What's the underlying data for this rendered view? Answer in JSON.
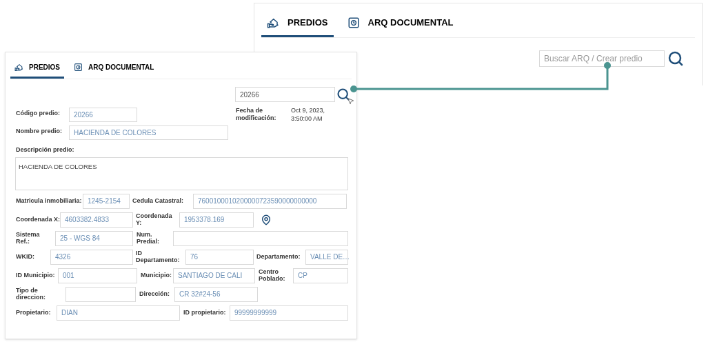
{
  "back_panel": {
    "tabs": [
      {
        "label": "PREDIOS",
        "kind": "house",
        "selected": true
      },
      {
        "label": "ARQ DOCUMENTAL",
        "kind": "document",
        "selected": false
      }
    ],
    "search": {
      "placeholder": "Buscar ARQ / Crear predio"
    }
  },
  "front_panel": {
    "tabs": [
      {
        "label": "PREDIOS",
        "kind": "house",
        "selected": true
      },
      {
        "label": "ARQ DOCUMENTAL",
        "kind": "document",
        "selected": false
      }
    ],
    "search": {
      "value": "20266"
    },
    "codigo": {
      "label": "Código predio:",
      "value": "20266"
    },
    "fecha": {
      "label": "Fecha de modificación:",
      "value": "Oct 9, 2023, 3:50:00 AM"
    },
    "nombre": {
      "label": "Nombre predio:",
      "value": "HACIENDA DE COLORES"
    },
    "descripcion": {
      "label": "Descripción predio:",
      "value": "HACIENDA DE COLORES"
    },
    "rows": [
      [
        {
          "label": "Matricula inmobiliaria:",
          "value": "1245-2154"
        },
        {
          "label": "Cedula Catastral:",
          "value": "7600100010200000723590000000000"
        }
      ],
      [
        {
          "label": "Coordenada X:",
          "value": "4603382.4833"
        },
        {
          "label": "Coordenada Y:",
          "value": "1953378.169"
        }
      ],
      [
        {
          "label": "Sistema Ref.:",
          "value": "25 - WGS 84"
        },
        {
          "label": "Num. Predial:"
        }
      ],
      [
        {
          "label": "WKID:",
          "value": "4326"
        },
        {
          "label": "ID Departamento:",
          "value": "76"
        },
        {
          "label": "Departamento:",
          "value": "VALLE DE…"
        }
      ],
      [
        {
          "label": "ID Municipio:",
          "value": "001"
        },
        {
          "label": "Municipio:",
          "value": "SANTIAGO DE CALI"
        },
        {
          "label": "Centro Poblado:",
          "value": "CP"
        }
      ],
      [
        {
          "label": "Tipo de direccion:"
        },
        {
          "label": "Dirección:",
          "value": "CR 32#24-56"
        }
      ],
      [
        {
          "label": "Propietario:",
          "value": "DIAN"
        },
        {
          "label": "ID propietario:",
          "value": "99999999999"
        }
      ]
    ]
  }
}
